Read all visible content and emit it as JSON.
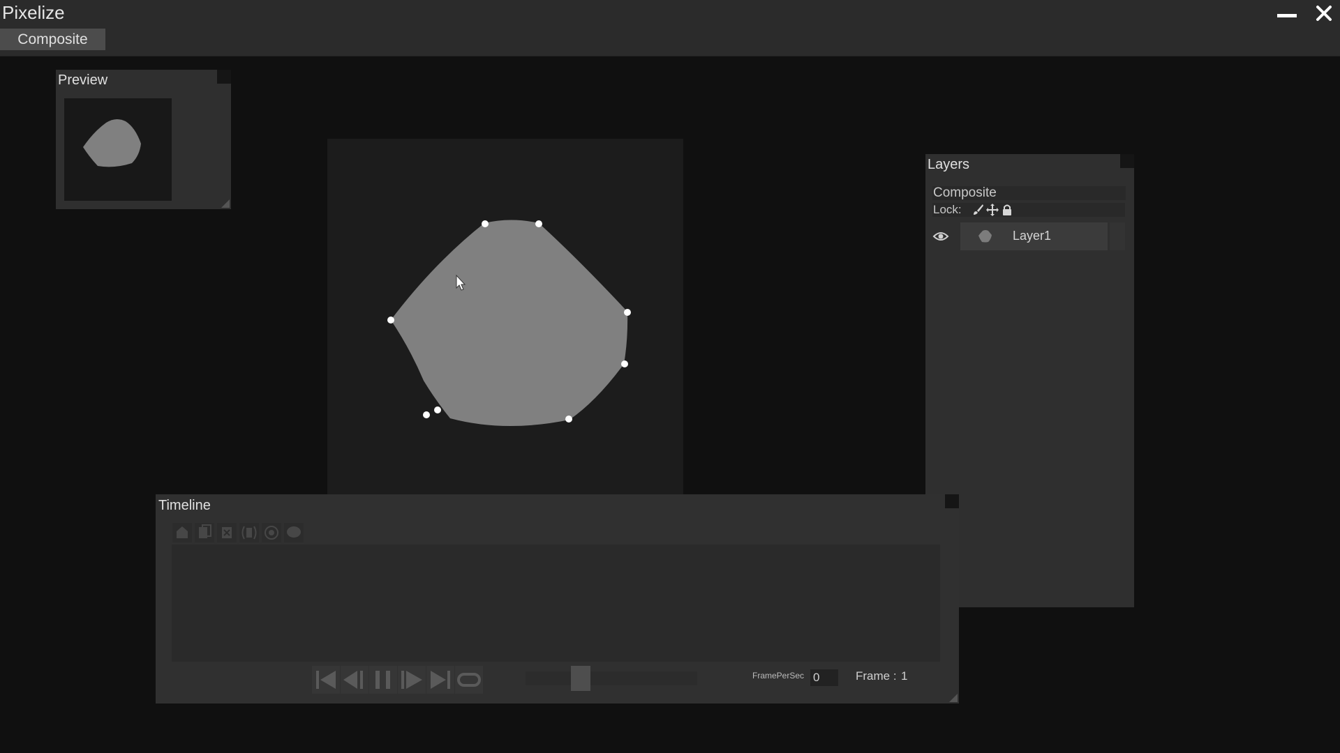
{
  "app": {
    "title": "Pixelize"
  },
  "tabs": [
    {
      "label": "Composite",
      "active": true
    }
  ],
  "icons": {
    "minimize": "minimize-icon",
    "close": "close-icon",
    "eye": "eye-icon",
    "lock_paint": "brush-icon",
    "lock_move": "move-icon",
    "lock_all": "lock-icon"
  },
  "preview": {
    "title": "Preview"
  },
  "layers": {
    "title": "Layers",
    "group_name": "Composite",
    "lock_label": "Lock:",
    "items": [
      {
        "name": "Layer1",
        "visible": true
      }
    ]
  },
  "timeline": {
    "title": "Timeline",
    "fps_label": "FramePerSec",
    "fps_value": "0",
    "frame_label": "Frame :",
    "frame_value": "1",
    "toolbar": [
      "add-frame-icon",
      "copy-frame-icon",
      "delete-frame-icon",
      "onion-skin-icon",
      "record-icon",
      "comment-icon"
    ],
    "playback": [
      "first-frame-icon",
      "previous-frame-icon",
      "pause-icon",
      "play-icon",
      "last-frame-icon",
      "loop-icon"
    ],
    "scrub_position": 0.3
  },
  "colors": {
    "shape_fill": "#808080",
    "handle": "#ffffff",
    "background": "#101010"
  }
}
